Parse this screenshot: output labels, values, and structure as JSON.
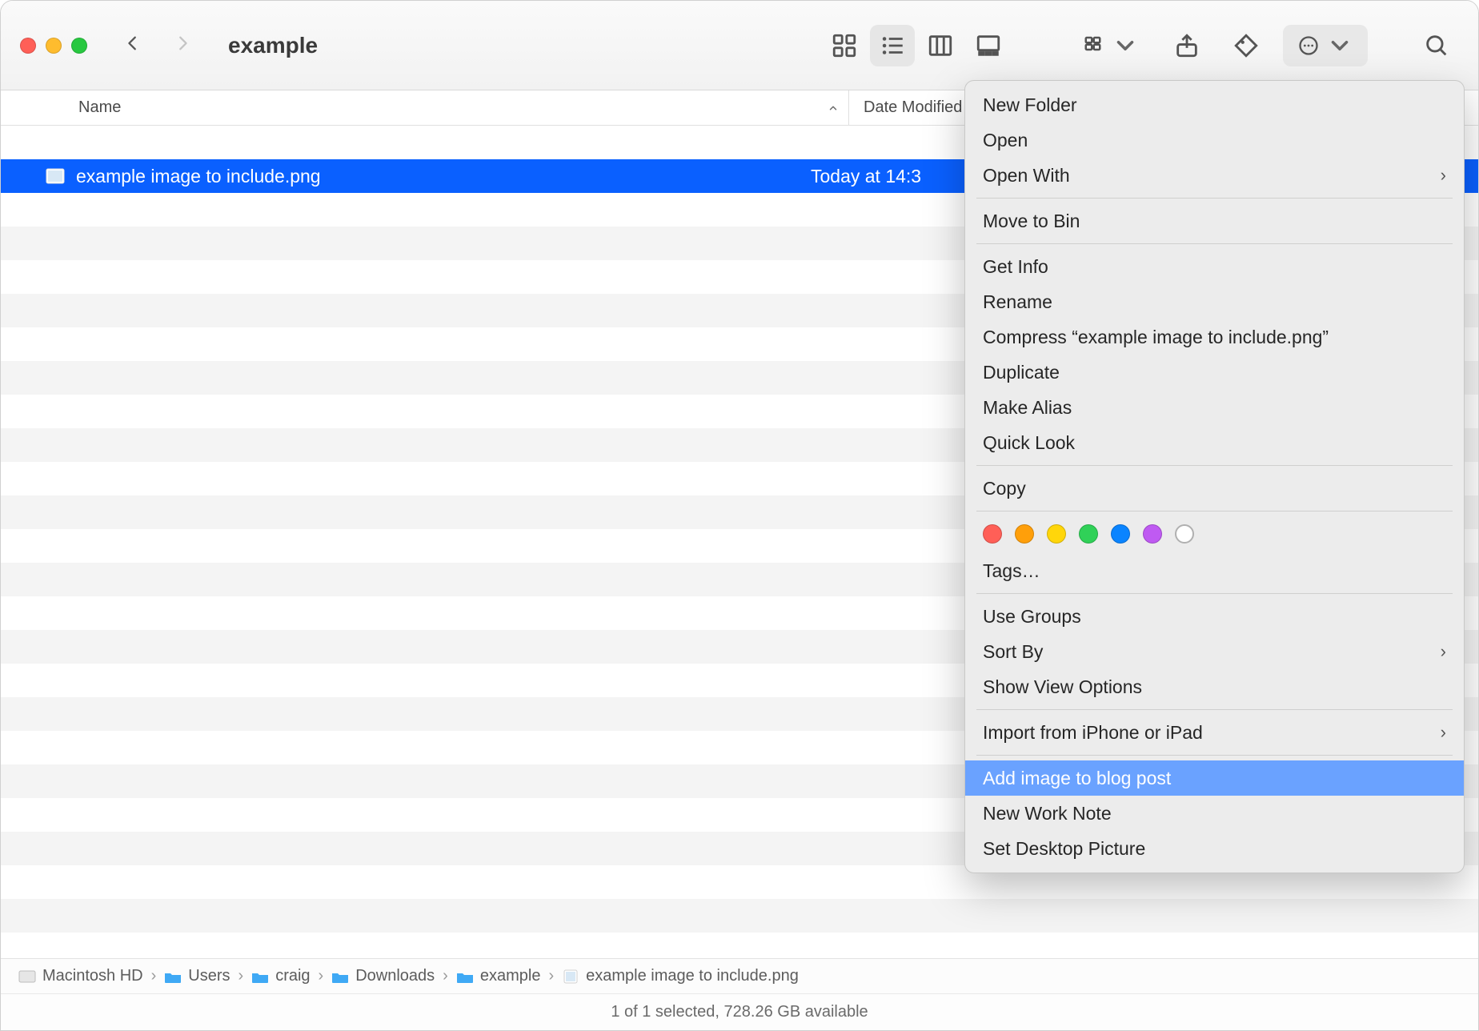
{
  "window": {
    "title": "example"
  },
  "columns": {
    "name": "Name",
    "date": "Date Modified"
  },
  "file": {
    "name": "example image to include.png",
    "date": "Today at 14:3"
  },
  "context_menu": {
    "new_folder": "New Folder",
    "open": "Open",
    "open_with": "Open With",
    "move_to_bin": "Move to Bin",
    "get_info": "Get Info",
    "rename": "Rename",
    "compress": "Compress “example image to include.png”",
    "duplicate": "Duplicate",
    "make_alias": "Make Alias",
    "quick_look": "Quick Look",
    "copy": "Copy",
    "tags": "Tags…",
    "use_groups": "Use Groups",
    "sort_by": "Sort By",
    "show_view_options": "Show View Options",
    "import_iphone": "Import from iPhone or iPad",
    "add_image_blog": "Add image to blog post",
    "new_work_note": "New Work Note",
    "set_desktop": "Set Desktop Picture"
  },
  "tag_colors": [
    "#ff5f57",
    "#ff9f0a",
    "#ffd60a",
    "#30d158",
    "#0a84ff",
    "#bf5af2"
  ],
  "path": {
    "hd": "Macintosh HD",
    "users": "Users",
    "user": "craig",
    "downloads": "Downloads",
    "folder": "example",
    "file": "example image to include.png"
  },
  "status": "1 of 1 selected, 728.26 GB available"
}
